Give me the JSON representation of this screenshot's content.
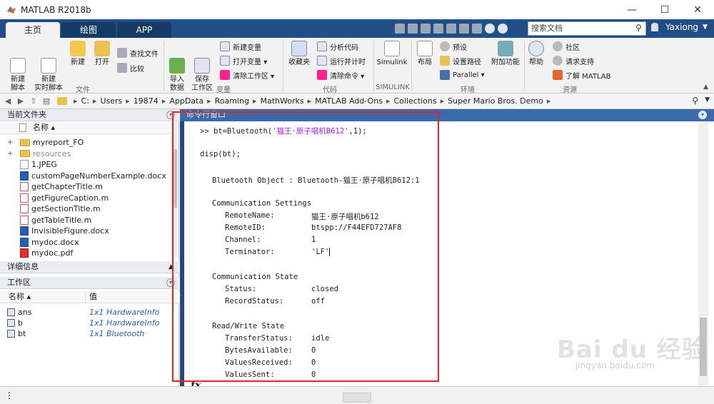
{
  "window": {
    "title": "MATLAB R2018b",
    "minimize": "—",
    "maximize": "☐",
    "close": "✕"
  },
  "tabs": [
    {
      "label": "主页"
    },
    {
      "label": "绘图"
    },
    {
      "label": "APP"
    }
  ],
  "search": {
    "placeholder": "搜索文档"
  },
  "user": {
    "name": "Yaxiong"
  },
  "ribbon": {
    "file": {
      "new_script": "新建\n脚本",
      "new_live_script": "新建\n实时脚本",
      "new": "新建",
      "open": "打开",
      "find_files": "查找文件",
      "compare": "比较",
      "group": "文件"
    },
    "variable": {
      "import": "导入\n数据",
      "save_ws": "保存\n工作区",
      "new_var": "新建变量",
      "open_var": "打开变量 ▾",
      "clear_ws": "清除工作区 ▾",
      "group": "变量"
    },
    "code": {
      "favorites": "收藏夹",
      "analyze": "分析代码",
      "run_time": "运行并计时",
      "clear_cmd": "清除命令 ▾",
      "group": "代码"
    },
    "simulink": {
      "simulink": "Simulink",
      "group": "SIMULINK"
    },
    "env": {
      "layout": "布局",
      "prefs": "预设",
      "set_path": "设置路径",
      "parallel": "Parallel ▾",
      "addons": "附加功能",
      "group": "环境"
    },
    "resources": {
      "help": "帮助",
      "community": "社区",
      "support": "请求支持",
      "learn": "了解 MATLAB",
      "group": "资源"
    }
  },
  "path": [
    "C:",
    "Users",
    "19874",
    "AppData",
    "Roaming",
    "MathWorks",
    "MATLAB Add-Ons",
    "Collections",
    "Super Mario Bros. Demo"
  ],
  "current_folder": {
    "title": "当前文件夹",
    "col_name": "名称 ▴",
    "files": [
      {
        "name": "myreport_FO",
        "type": "fold",
        "expand": "+",
        "dim": false
      },
      {
        "name": "resources",
        "type": "fold",
        "expand": "+",
        "dim": true
      },
      {
        "name": "1.JPEG",
        "type": "img",
        "expand": "",
        "dim": false
      },
      {
        "name": "customPageNumberExample.docx",
        "type": "docx",
        "expand": "",
        "dim": false
      },
      {
        "name": "getChapterTitle.m",
        "type": "m",
        "expand": "",
        "dim": false
      },
      {
        "name": "getFigureCaption.m",
        "type": "m",
        "expand": "",
        "dim": false
      },
      {
        "name": "getSectionTitle.m",
        "type": "m",
        "expand": "",
        "dim": false
      },
      {
        "name": "getTableTitle.m",
        "type": "m",
        "expand": "",
        "dim": false
      },
      {
        "name": "InvisibleFigure.docx",
        "type": "docx",
        "expand": "",
        "dim": false
      },
      {
        "name": "mydoc.docx",
        "type": "docx",
        "expand": "",
        "dim": false
      },
      {
        "name": "mydoc.pdf",
        "type": "pdf",
        "expand": "",
        "dim": false
      }
    ]
  },
  "details": {
    "title": "详细信息"
  },
  "workspace": {
    "title": "工作区",
    "col_name": "名称 ▴",
    "col_value": "值",
    "vars": [
      {
        "name": "ans",
        "value": "1x1 HardwareInfo"
      },
      {
        "name": "b",
        "value": "1x1 HardwareInfo"
      },
      {
        "name": "bt",
        "value": "1x1 Bluetooth"
      }
    ]
  },
  "command_window": {
    "title": "命令行窗口",
    "cmd_prefix": ">> bt=Bluetooth(",
    "cmd_str": "'猫王·原子唱机B612'",
    "cmd_suffix": ",1);",
    "disp": "disp(bt);",
    "obj_line": "Bluetooth Object : Bluetooth-猫王·原子唱机B612:1",
    "comm_settings": "Communication Settings",
    "remote_name_k": "RemoteName:",
    "remote_name_v": "猫王·原子唱机b612",
    "remote_id_k": "RemoteID:",
    "remote_id_v": "btspp://F44EFD727AF8",
    "channel_k": "Channel:",
    "channel_v": "1",
    "terminator_k": "Terminator:",
    "terminator_v": "'LF'",
    "comm_state": "Communication State",
    "status_k": "Status:",
    "status_v": "closed",
    "record_k": "RecordStatus:",
    "record_v": "off",
    "rw_state": "Read/Write State",
    "transfer_k": "TransferStatus:",
    "transfer_v": "idle",
    "bytes_k": "BytesAvailable:",
    "bytes_v": "0",
    "vrecv_k": "ValuesReceived:",
    "vrecv_v": "0",
    "vsent_k": "ValuesSent:",
    "vsent_v": "0",
    "fx": "fx"
  },
  "watermark": {
    "text": "Bai du 经验",
    "sub": "jingyan.baidu.com"
  },
  "colors": {
    "accent": "#1f4f86",
    "cmd_header": "#3b6aa8",
    "highlight_box": "#e8232a",
    "string": "#a020f0"
  }
}
